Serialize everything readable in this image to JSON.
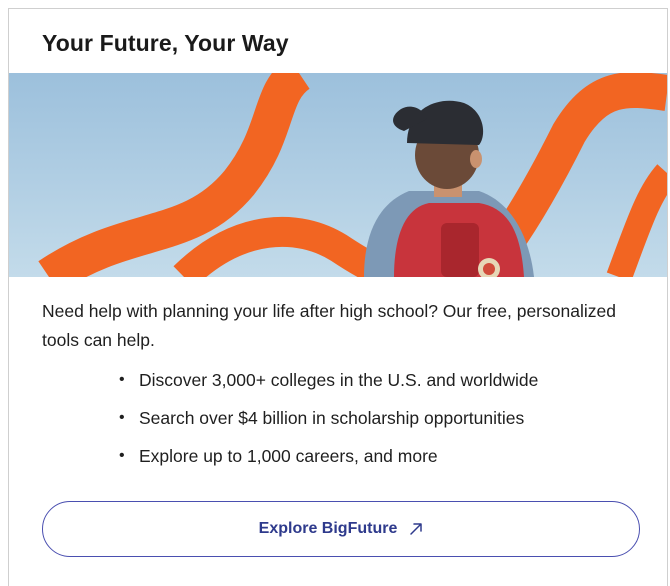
{
  "card": {
    "title": "Your Future, Your Way",
    "hero_image": "student-with-backpack-photo",
    "intro": "Need help with planning your life after high school? Our free, personalized tools can help.",
    "benefits": [
      "Discover 3,000+ colleges in the U.S. and worldwide",
      "Search over $4 billion in scholarship opportunities",
      "Explore up to 1,000 careers, and more"
    ],
    "cta": {
      "label": "Explore BigFuture",
      "icon": "arrow-up-right-icon"
    }
  },
  "colors": {
    "title_text": "#1a1a1a",
    "body_text": "#1f1f1f",
    "cta_border": "#4a4fb0",
    "cta_text": "#2e3a8c",
    "accent_orange": "#f26522",
    "sky": "#a9c9e0"
  }
}
